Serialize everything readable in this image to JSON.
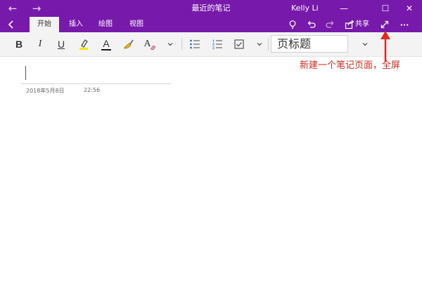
{
  "window": {
    "title": "最近的笔记",
    "user": "Kelly Li",
    "back_icon": "arrow-left-icon",
    "forward_icon": "arrow-right-icon",
    "minimize_glyph": "—",
    "maximize_glyph": "☐",
    "close_glyph": "✕"
  },
  "ribbon": {
    "tabs": [
      {
        "label": "开始",
        "active": true
      },
      {
        "label": "插入",
        "active": false
      },
      {
        "label": "绘图",
        "active": false
      },
      {
        "label": "视图",
        "active": false
      }
    ],
    "share_label": "共享",
    "more_glyph": "···"
  },
  "toolbar": {
    "bold": "B",
    "italic": "I",
    "underline": "U",
    "font_color_letter": "A",
    "clear_format_letter": "A",
    "style_label": "页标题",
    "highlight_color": "#f7e600",
    "font_color_bar": "#1a1a1a"
  },
  "page": {
    "date": "2018年5月8日",
    "time": "22:56"
  },
  "annotation": {
    "text": "新建一个笔记页面，全屏",
    "color": "#cc2a1e"
  },
  "colors": {
    "accent": "#7719aa",
    "toolbar_bg": "#f3f3f3"
  }
}
